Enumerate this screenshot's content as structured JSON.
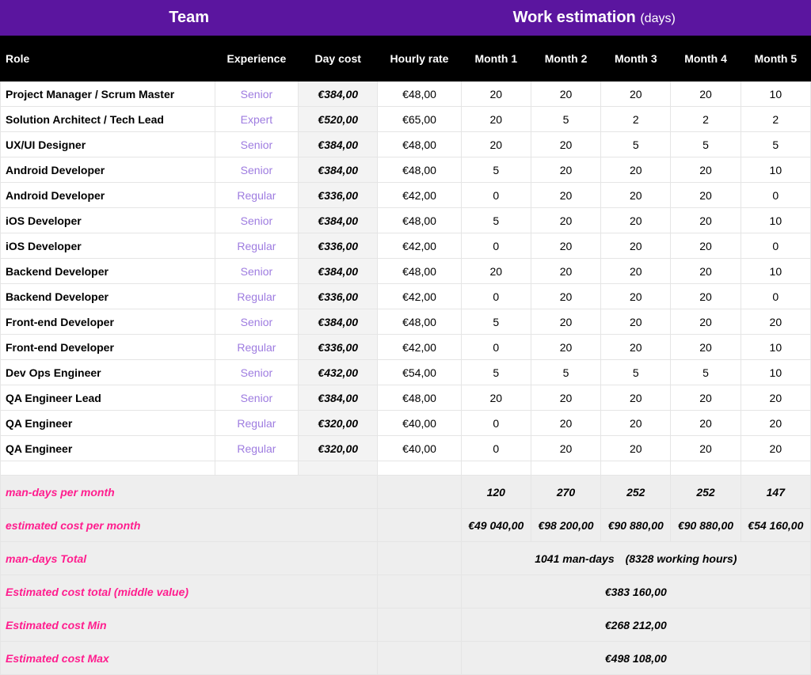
{
  "header": {
    "team_label": "Team",
    "work_label": "Work estimation",
    "work_sub": "(days)"
  },
  "columns": {
    "role": "Role",
    "exp": "Experience",
    "daycost": "Day cost",
    "rate": "Hourly rate",
    "m1": "Month 1",
    "m2": "Month 2",
    "m3": "Month 3",
    "m4": "Month 4",
    "m5": "Month 5"
  },
  "rows": [
    {
      "role": "Project Manager / Scrum Master",
      "exp": "Senior",
      "daycost": "€384,00",
      "rate": "€48,00",
      "m1": "20",
      "m2": "20",
      "m3": "20",
      "m4": "20",
      "m5": "10"
    },
    {
      "role": "Solution Architect / Tech Lead",
      "exp": "Expert",
      "daycost": "€520,00",
      "rate": "€65,00",
      "m1": "20",
      "m2": "5",
      "m3": "2",
      "m4": "2",
      "m5": "2"
    },
    {
      "role": "UX/UI Designer",
      "exp": "Senior",
      "daycost": "€384,00",
      "rate": "€48,00",
      "m1": "20",
      "m2": "20",
      "m3": "5",
      "m4": "5",
      "m5": "5"
    },
    {
      "role": "Android Developer",
      "exp": "Senior",
      "daycost": "€384,00",
      "rate": "€48,00",
      "m1": "5",
      "m2": "20",
      "m3": "20",
      "m4": "20",
      "m5": "10"
    },
    {
      "role": "Android Developer",
      "exp": "Regular",
      "daycost": "€336,00",
      "rate": "€42,00",
      "m1": "0",
      "m2": "20",
      "m3": "20",
      "m4": "20",
      "m5": "0"
    },
    {
      "role": "iOS Developer",
      "exp": "Senior",
      "daycost": "€384,00",
      "rate": "€48,00",
      "m1": "5",
      "m2": "20",
      "m3": "20",
      "m4": "20",
      "m5": "10"
    },
    {
      "role": "iOS Developer",
      "exp": "Regular",
      "daycost": "€336,00",
      "rate": "€42,00",
      "m1": "0",
      "m2": "20",
      "m3": "20",
      "m4": "20",
      "m5": "0"
    },
    {
      "role": "Backend Developer",
      "exp": "Senior",
      "daycost": "€384,00",
      "rate": "€48,00",
      "m1": "20",
      "m2": "20",
      "m3": "20",
      "m4": "20",
      "m5": "10"
    },
    {
      "role": "Backend Developer",
      "exp": "Regular",
      "daycost": "€336,00",
      "rate": "€42,00",
      "m1": "0",
      "m2": "20",
      "m3": "20",
      "m4": "20",
      "m5": "0"
    },
    {
      "role": "Front-end Developer",
      "exp": "Senior",
      "daycost": "€384,00",
      "rate": "€48,00",
      "m1": "5",
      "m2": "20",
      "m3": "20",
      "m4": "20",
      "m5": "20"
    },
    {
      "role": "Front-end Developer",
      "exp": "Regular",
      "daycost": "€336,00",
      "rate": "€42,00",
      "m1": "0",
      "m2": "20",
      "m3": "20",
      "m4": "20",
      "m5": "10"
    },
    {
      "role": "Dev Ops Engineer",
      "exp": "Senior",
      "daycost": "€432,00",
      "rate": "€54,00",
      "m1": "5",
      "m2": "5",
      "m3": "5",
      "m4": "5",
      "m5": "10"
    },
    {
      "role": "QA Engineer  Lead",
      "exp": "Senior",
      "daycost": "€384,00",
      "rate": "€48,00",
      "m1": "20",
      "m2": "20",
      "m3": "20",
      "m4": "20",
      "m5": "20"
    },
    {
      "role": "QA Engineer",
      "exp": "Regular",
      "daycost": "€320,00",
      "rate": "€40,00",
      "m1": "0",
      "m2": "20",
      "m3": "20",
      "m4": "20",
      "m5": "20"
    },
    {
      "role": "QA Engineer",
      "exp": "Regular",
      "daycost": "€320,00",
      "rate": "€40,00",
      "m1": "0",
      "m2": "20",
      "m3": "20",
      "m4": "20",
      "m5": "20"
    }
  ],
  "summary": {
    "mandays_label": "man-days per month",
    "mandays": {
      "m1": "120",
      "m2": "270",
      "m3": "252",
      "m4": "252",
      "m5": "147"
    },
    "cost_label": "estimated cost per month",
    "cost": {
      "m1": "€49 040,00",
      "m2": "€98 200,00",
      "m3": "€90 880,00",
      "m4": "€90 880,00",
      "m5": "€54 160,00"
    },
    "total_mandays_label": "man-days Total",
    "total_mandays_value": "1041 man-days (8328 working hours)",
    "total_mid_label": "Estimated cost total (middle value)",
    "total_mid_value": "€383 160,00",
    "total_min_label": "Estimated cost Min",
    "total_min_value": "€268 212,00",
    "total_max_label": "Estimated cost Max",
    "total_max_value": "€498 108,00"
  },
  "chart_data": {
    "type": "table",
    "title": "Work estimation (days)",
    "roles": [
      "Project Manager / Scrum Master",
      "Solution Architect / Tech Lead",
      "UX/UI Designer",
      "Android Developer",
      "Android Developer",
      "iOS Developer",
      "iOS Developer",
      "Backend Developer",
      "Backend Developer",
      "Front-end Developer",
      "Front-end Developer",
      "Dev Ops Engineer",
      "QA Engineer Lead",
      "QA Engineer",
      "QA Engineer"
    ],
    "experience": [
      "Senior",
      "Expert",
      "Senior",
      "Senior",
      "Regular",
      "Senior",
      "Regular",
      "Senior",
      "Regular",
      "Senior",
      "Regular",
      "Senior",
      "Senior",
      "Regular",
      "Regular"
    ],
    "day_cost_eur": [
      384,
      520,
      384,
      384,
      336,
      384,
      336,
      384,
      336,
      384,
      336,
      432,
      384,
      320,
      320
    ],
    "hourly_rate_eur": [
      48,
      65,
      48,
      48,
      42,
      48,
      42,
      48,
      42,
      48,
      42,
      54,
      48,
      40,
      40
    ],
    "months": [
      "Month 1",
      "Month 2",
      "Month 3",
      "Month 4",
      "Month 5"
    ],
    "days_matrix": [
      [
        20,
        20,
        20,
        20,
        10
      ],
      [
        20,
        5,
        2,
        2,
        2
      ],
      [
        20,
        20,
        5,
        5,
        5
      ],
      [
        5,
        20,
        20,
        20,
        10
      ],
      [
        0,
        20,
        20,
        20,
        0
      ],
      [
        5,
        20,
        20,
        20,
        10
      ],
      [
        0,
        20,
        20,
        20,
        0
      ],
      [
        20,
        20,
        20,
        20,
        10
      ],
      [
        0,
        20,
        20,
        20,
        0
      ],
      [
        5,
        20,
        20,
        20,
        20
      ],
      [
        0,
        20,
        20,
        20,
        10
      ],
      [
        5,
        5,
        5,
        5,
        10
      ],
      [
        20,
        20,
        20,
        20,
        20
      ],
      [
        0,
        20,
        20,
        20,
        20
      ],
      [
        0,
        20,
        20,
        20,
        20
      ]
    ],
    "man_days_per_month": [
      120,
      270,
      252,
      252,
      147
    ],
    "cost_per_month_eur": [
      49040,
      98200,
      90880,
      90880,
      54160
    ],
    "man_days_total": 1041,
    "working_hours_total": 8328,
    "estimated_cost_total_mid_eur": 383160,
    "estimated_cost_min_eur": 268212,
    "estimated_cost_max_eur": 498108
  }
}
